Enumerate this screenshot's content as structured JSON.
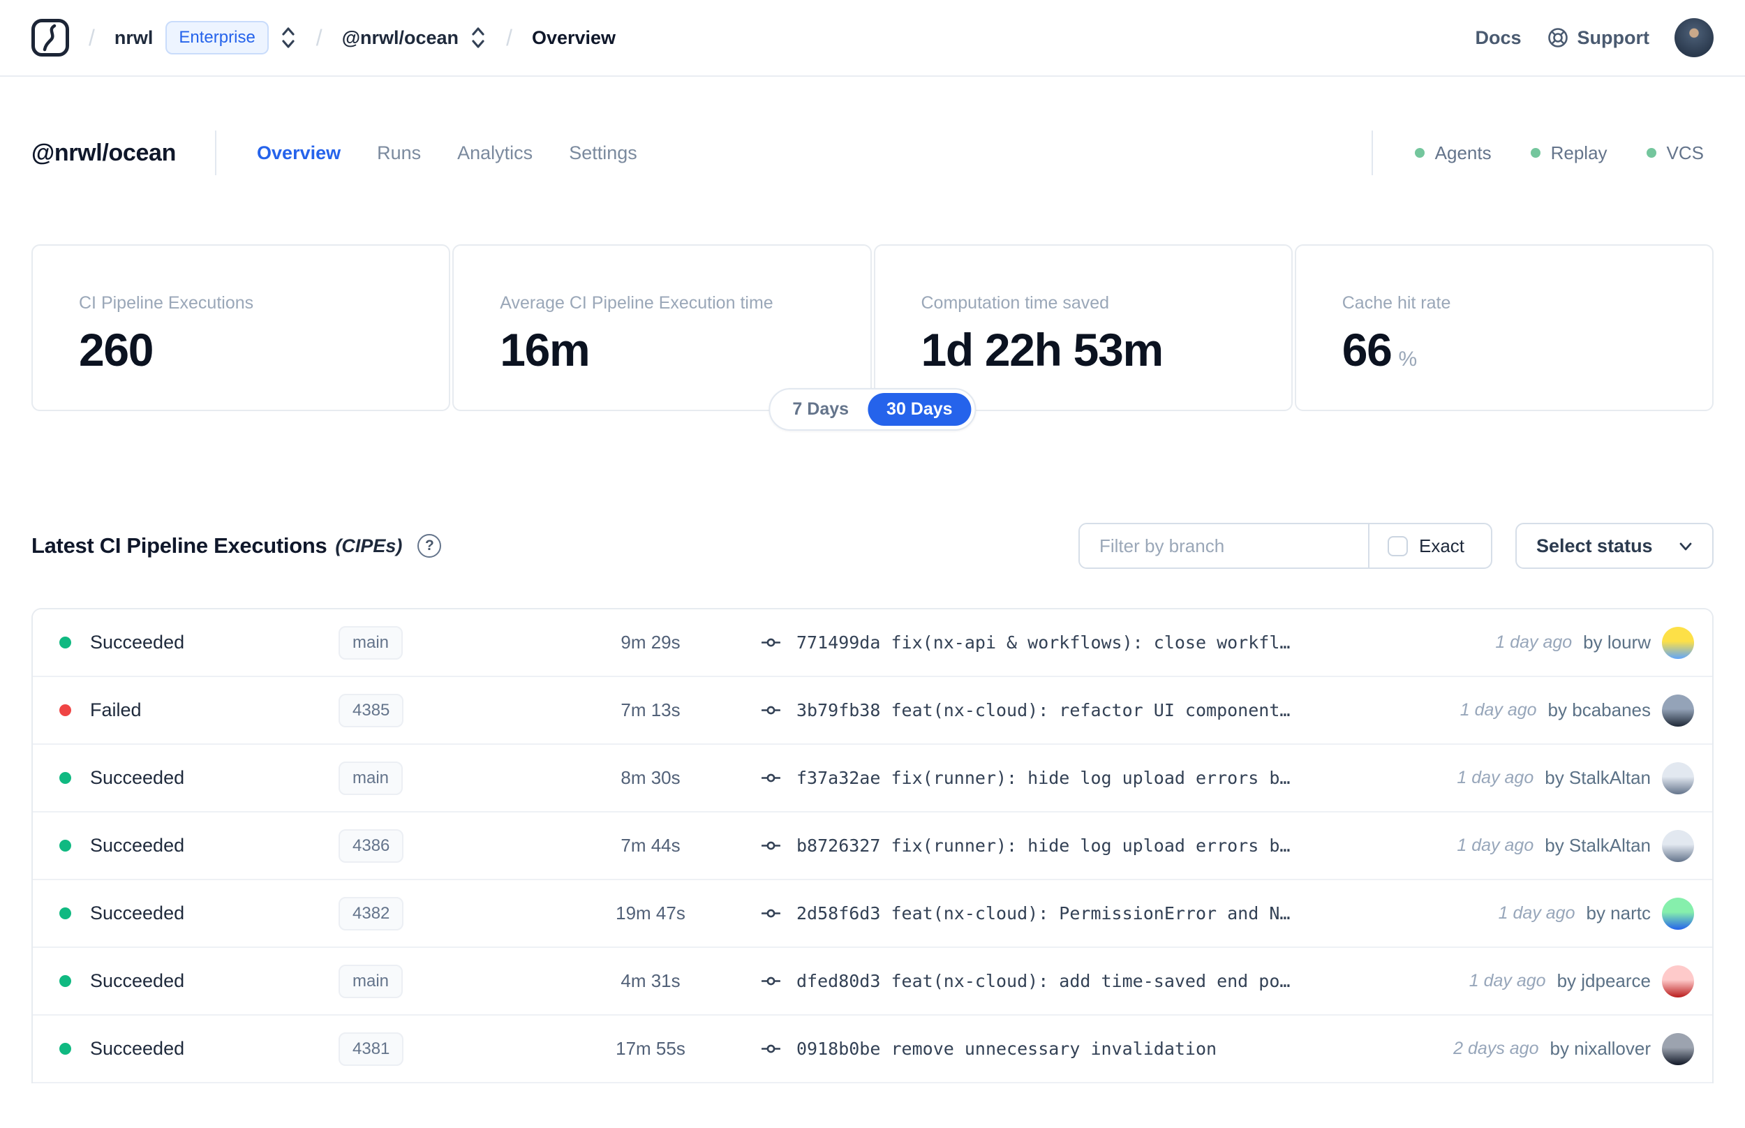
{
  "nav": {
    "logo_name": "nx-cloud-logo",
    "breadcrumb": {
      "separator": "/",
      "org": "nrwl",
      "org_badge": "Enterprise",
      "workspace": "@nrwl/ocean",
      "page": "Overview"
    },
    "links": {
      "docs": "Docs",
      "support": "Support"
    }
  },
  "header": {
    "title": "@nrwl/ocean",
    "tabs": [
      {
        "label": "Overview",
        "active": true
      },
      {
        "label": "Runs",
        "active": false
      },
      {
        "label": "Analytics",
        "active": false
      },
      {
        "label": "Settings",
        "active": false
      }
    ],
    "indicators": [
      {
        "label": "Agents",
        "color": "#74c69d"
      },
      {
        "label": "Replay",
        "color": "#74c69d"
      },
      {
        "label": "VCS",
        "color": "#74c69d"
      }
    ]
  },
  "stats": {
    "cards": [
      {
        "label": "CI Pipeline Executions",
        "value": "260",
        "suffix": ""
      },
      {
        "label": "Average CI Pipeline Execution time",
        "value": "16m",
        "suffix": ""
      },
      {
        "label": "Computation time saved",
        "value": "1d 22h 53m",
        "suffix": ""
      },
      {
        "label": "Cache hit rate",
        "value": "66",
        "suffix": "%"
      }
    ],
    "range_toggle": {
      "options": [
        "7 Days",
        "30 Days"
      ],
      "selected": "30 Days"
    }
  },
  "cipes": {
    "title": "Latest CI Pipeline Executions",
    "title_suffix": "(CIPEs)",
    "help_glyph": "?",
    "filter": {
      "branch_placeholder": "Filter by branch",
      "exact_label": "Exact",
      "status_label": "Select status"
    },
    "rows": [
      {
        "status": "Succeeded",
        "status_color": "#10b981",
        "branch": "main",
        "duration": "9m 29s",
        "commit": "771499da",
        "message": "fix(nx-api & workflows): close workfl…",
        "time": "1 day ago",
        "author": "by lourw",
        "avatar": {
          "from": "#fde047",
          "to": "#60a5fa"
        }
      },
      {
        "status": "Failed",
        "status_color": "#ef4444",
        "branch": "4385",
        "duration": "7m 13s",
        "commit": "3b79fb38",
        "message": "feat(nx-cloud): refactor UI component…",
        "time": "1 day ago",
        "author": "by bcabanes",
        "avatar": {
          "from": "#94a3b8",
          "to": "#1f2937"
        }
      },
      {
        "status": "Succeeded",
        "status_color": "#10b981",
        "branch": "main",
        "duration": "8m 30s",
        "commit": "f37a32ae",
        "message": "fix(runner): hide log upload errors b…",
        "time": "1 day ago",
        "author": "by StalkAltan",
        "avatar": {
          "from": "#e2e8f0",
          "to": "#64748b"
        }
      },
      {
        "status": "Succeeded",
        "status_color": "#10b981",
        "branch": "4386",
        "duration": "7m 44s",
        "commit": "b8726327",
        "message": "fix(runner): hide log upload errors b…",
        "time": "1 day ago",
        "author": "by StalkAltan",
        "avatar": {
          "from": "#e2e8f0",
          "to": "#64748b"
        }
      },
      {
        "status": "Succeeded",
        "status_color": "#10b981",
        "branch": "4382",
        "duration": "19m 47s",
        "commit": "2d58f6d3",
        "message": "feat(nx-cloud): PermissionError and N…",
        "time": "1 day ago",
        "author": "by nartc",
        "avatar": {
          "from": "#86efac",
          "to": "#2563eb"
        }
      },
      {
        "status": "Succeeded",
        "status_color": "#10b981",
        "branch": "main",
        "duration": "4m 31s",
        "commit": "dfed80d3",
        "message": "feat(nx-cloud): add time-saved end po…",
        "time": "1 day ago",
        "author": "by jdpearce",
        "avatar": {
          "from": "#fecaca",
          "to": "#b91c1c"
        }
      },
      {
        "status": "Succeeded",
        "status_color": "#10b981",
        "branch": "4381",
        "duration": "17m 55s",
        "commit": "0918b0be",
        "message": "remove unnecessary invalidation",
        "time": "2 days ago",
        "author": "by nixallover",
        "avatar": {
          "from": "#9ca3af",
          "to": "#111827"
        }
      }
    ]
  }
}
